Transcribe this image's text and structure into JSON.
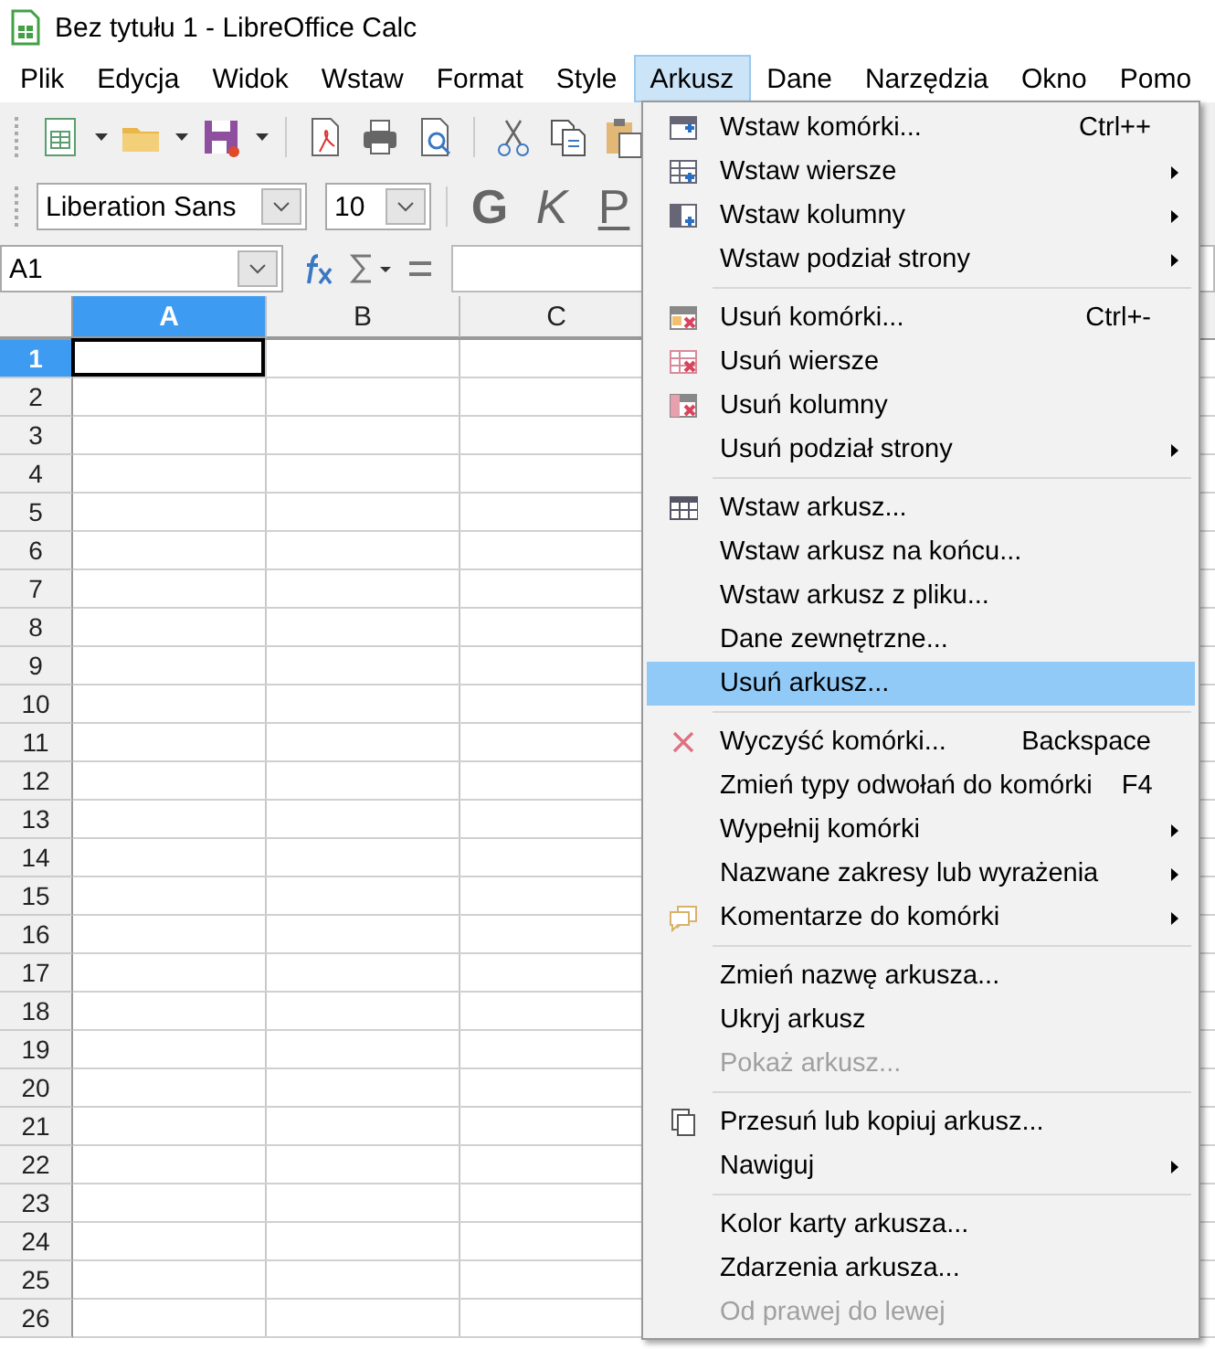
{
  "window": {
    "title": "Bez tytułu 1 - LibreOffice Calc"
  },
  "menu_bar": [
    {
      "label": "Plik",
      "selected": false
    },
    {
      "label": "Edycja",
      "selected": false
    },
    {
      "label": "Widok",
      "selected": false
    },
    {
      "label": "Wstaw",
      "selected": false
    },
    {
      "label": "Format",
      "selected": false
    },
    {
      "label": "Style",
      "selected": false
    },
    {
      "label": "Arkusz",
      "selected": true
    },
    {
      "label": "Dane",
      "selected": false
    },
    {
      "label": "Narzędzia",
      "selected": false
    },
    {
      "label": "Okno",
      "selected": false
    },
    {
      "label": "Pomo",
      "selected": false
    }
  ],
  "formatting_toolbar": {
    "font_name": "Liberation Sans",
    "font_size": "10",
    "buttons": [
      {
        "label": "G",
        "kind": "bold"
      },
      {
        "label": "K",
        "kind": "italic"
      },
      {
        "label": "P",
        "kind": "underline"
      }
    ]
  },
  "formula_bar": {
    "name_box": "A1"
  },
  "sheet": {
    "columns": [
      {
        "label": "A",
        "selected": true
      },
      {
        "label": "B",
        "selected": false
      },
      {
        "label": "C",
        "selected": false
      }
    ],
    "rows": [
      {
        "label": "1",
        "selected": true
      },
      {
        "label": "2",
        "selected": false
      },
      {
        "label": "3",
        "selected": false
      },
      {
        "label": "4",
        "selected": false
      },
      {
        "label": "5",
        "selected": false
      },
      {
        "label": "6",
        "selected": false
      },
      {
        "label": "7",
        "selected": false
      },
      {
        "label": "8",
        "selected": false
      },
      {
        "label": "9",
        "selected": false
      },
      {
        "label": "10",
        "selected": false
      },
      {
        "label": "11",
        "selected": false
      },
      {
        "label": "12",
        "selected": false
      },
      {
        "label": "13",
        "selected": false
      },
      {
        "label": "14",
        "selected": false
      },
      {
        "label": "15",
        "selected": false
      },
      {
        "label": "16",
        "selected": false
      },
      {
        "label": "17",
        "selected": false
      },
      {
        "label": "18",
        "selected": false
      },
      {
        "label": "19",
        "selected": false
      },
      {
        "label": "20",
        "selected": false
      },
      {
        "label": "21",
        "selected": false
      },
      {
        "label": "22",
        "selected": false
      },
      {
        "label": "23",
        "selected": false
      },
      {
        "label": "24",
        "selected": false
      },
      {
        "label": "25",
        "selected": false
      },
      {
        "label": "26",
        "selected": false
      }
    ]
  },
  "dropdown_menu": [
    {
      "kind": "item",
      "label": "Wstaw komórki...",
      "shortcut": "Ctrl++",
      "submenu": false,
      "disabled": false,
      "selected": false
    },
    {
      "kind": "item",
      "label": "Wstaw wiersze",
      "submenu": true,
      "disabled": false,
      "selected": false
    },
    {
      "kind": "item",
      "label": "Wstaw kolumny",
      "submenu": true,
      "disabled": false,
      "selected": false
    },
    {
      "kind": "item",
      "label": "Wstaw podział strony",
      "submenu": true,
      "disabled": false,
      "selected": false
    },
    {
      "kind": "separator"
    },
    {
      "kind": "item",
      "label": "Usuń komórki...",
      "shortcut": "Ctrl+-",
      "submenu": false,
      "disabled": false,
      "selected": false
    },
    {
      "kind": "item",
      "label": "Usuń wiersze",
      "submenu": false,
      "disabled": false,
      "selected": false
    },
    {
      "kind": "item",
      "label": "Usuń kolumny",
      "submenu": false,
      "disabled": false,
      "selected": false
    },
    {
      "kind": "item",
      "label": "Usuń podział strony",
      "submenu": true,
      "disabled": false,
      "selected": false
    },
    {
      "kind": "separator"
    },
    {
      "kind": "item",
      "label": "Wstaw arkusz...",
      "submenu": false,
      "disabled": false,
      "selected": false
    },
    {
      "kind": "item",
      "label": "Wstaw arkusz na końcu...",
      "submenu": false,
      "disabled": false,
      "selected": false
    },
    {
      "kind": "item",
      "label": "Wstaw arkusz z pliku...",
      "submenu": false,
      "disabled": false,
      "selected": false
    },
    {
      "kind": "item",
      "label": "Dane zewnętrzne...",
      "submenu": false,
      "disabled": false,
      "selected": false
    },
    {
      "kind": "item",
      "label": "Usuń arkusz...",
      "submenu": false,
      "disabled": false,
      "selected": true
    },
    {
      "kind": "separator"
    },
    {
      "kind": "item",
      "label": "Wyczyść komórki...",
      "shortcut": "Backspace",
      "submenu": false,
      "disabled": false,
      "selected": false
    },
    {
      "kind": "item",
      "label": "Zmień typy odwołań do komórki",
      "shortcut": "F4",
      "submenu": false,
      "disabled": false,
      "selected": false
    },
    {
      "kind": "item",
      "label": "Wypełnij komórki",
      "submenu": true,
      "disabled": false,
      "selected": false
    },
    {
      "kind": "item",
      "label": "Nazwane zakresy lub wyrażenia",
      "submenu": true,
      "disabled": false,
      "selected": false
    },
    {
      "kind": "item",
      "label": "Komentarze do komórki",
      "submenu": true,
      "disabled": false,
      "selected": false
    },
    {
      "kind": "separator"
    },
    {
      "kind": "item",
      "label": "Zmień nazwę arkusza...",
      "submenu": false,
      "disabled": false,
      "selected": false
    },
    {
      "kind": "item",
      "label": "Ukryj arkusz",
      "submenu": false,
      "disabled": false,
      "selected": false
    },
    {
      "kind": "item",
      "label": "Pokaż arkusz...",
      "submenu": false,
      "disabled": true,
      "selected": false
    },
    {
      "kind": "separator"
    },
    {
      "kind": "item",
      "label": "Przesuń lub kopiuj arkusz...",
      "submenu": false,
      "disabled": false,
      "selected": false
    },
    {
      "kind": "item",
      "label": "Nawiguj",
      "submenu": true,
      "disabled": false,
      "selected": false
    },
    {
      "kind": "separator"
    },
    {
      "kind": "item",
      "label": "Kolor karty arkusza...",
      "submenu": false,
      "disabled": false,
      "selected": false
    },
    {
      "kind": "item",
      "label": "Zdarzenia arkusza...",
      "submenu": false,
      "disabled": false,
      "selected": false
    },
    {
      "kind": "item",
      "label": "Od prawej do lewej",
      "submenu": false,
      "disabled": true,
      "selected": false
    }
  ]
}
